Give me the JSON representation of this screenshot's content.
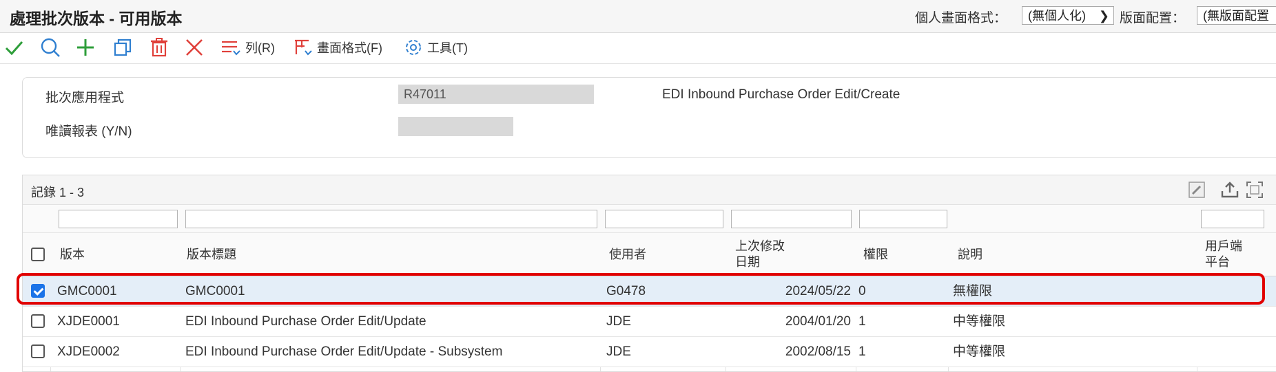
{
  "window": {
    "title": "處理批次版本 - 可用版本",
    "personal_format_label": "個人畫面格式：",
    "personal_format_value": "(無個人化)",
    "layout_label": "版面配置：",
    "layout_value": "(無版面配置"
  },
  "toolbar": {
    "row_label": "列(R)",
    "format_label": "畫面格式(F)",
    "tools_label": "工具(T)"
  },
  "header": {
    "app_label": "批次應用程式",
    "app_value": "R47011",
    "app_desc": "EDI Inbound Purchase Order Edit/Create",
    "readonly_label": "唯讀報表 (Y/N)",
    "readonly_value": ""
  },
  "grid": {
    "record_count": "記錄 1 - 3",
    "columns": {
      "version": "版本",
      "title": "版本標題",
      "user": "使用者",
      "modified_line1": "上次修改",
      "modified_line2": "日期",
      "security": "權限",
      "description": "說明",
      "platform_line1": "用戶端",
      "platform_line2": "平台"
    },
    "rows": [
      {
        "version": "GMC0001",
        "title": "GMC0001",
        "user": "G0478",
        "date": "2024/05/22",
        "security": "0",
        "description": "無權限",
        "selected": true
      },
      {
        "version": "XJDE0001",
        "title": "EDI Inbound Purchase Order Edit/Update",
        "user": "JDE",
        "date": "2004/01/20",
        "security": "1",
        "description": "中等權限",
        "selected": false
      },
      {
        "version": "XJDE0002",
        "title": "EDI Inbound Purchase Order Edit/Update - Subsystem",
        "user": "JDE",
        "date": "2002/08/15",
        "security": "1",
        "description": "中等權限",
        "selected": false
      }
    ]
  },
  "colors": {
    "accent": "#1a73e8",
    "highlight_border": "#e10000",
    "ok_green": "#2e9e3a",
    "icon_blue": "#2f7fd0",
    "delete_red": "#e0403a"
  }
}
